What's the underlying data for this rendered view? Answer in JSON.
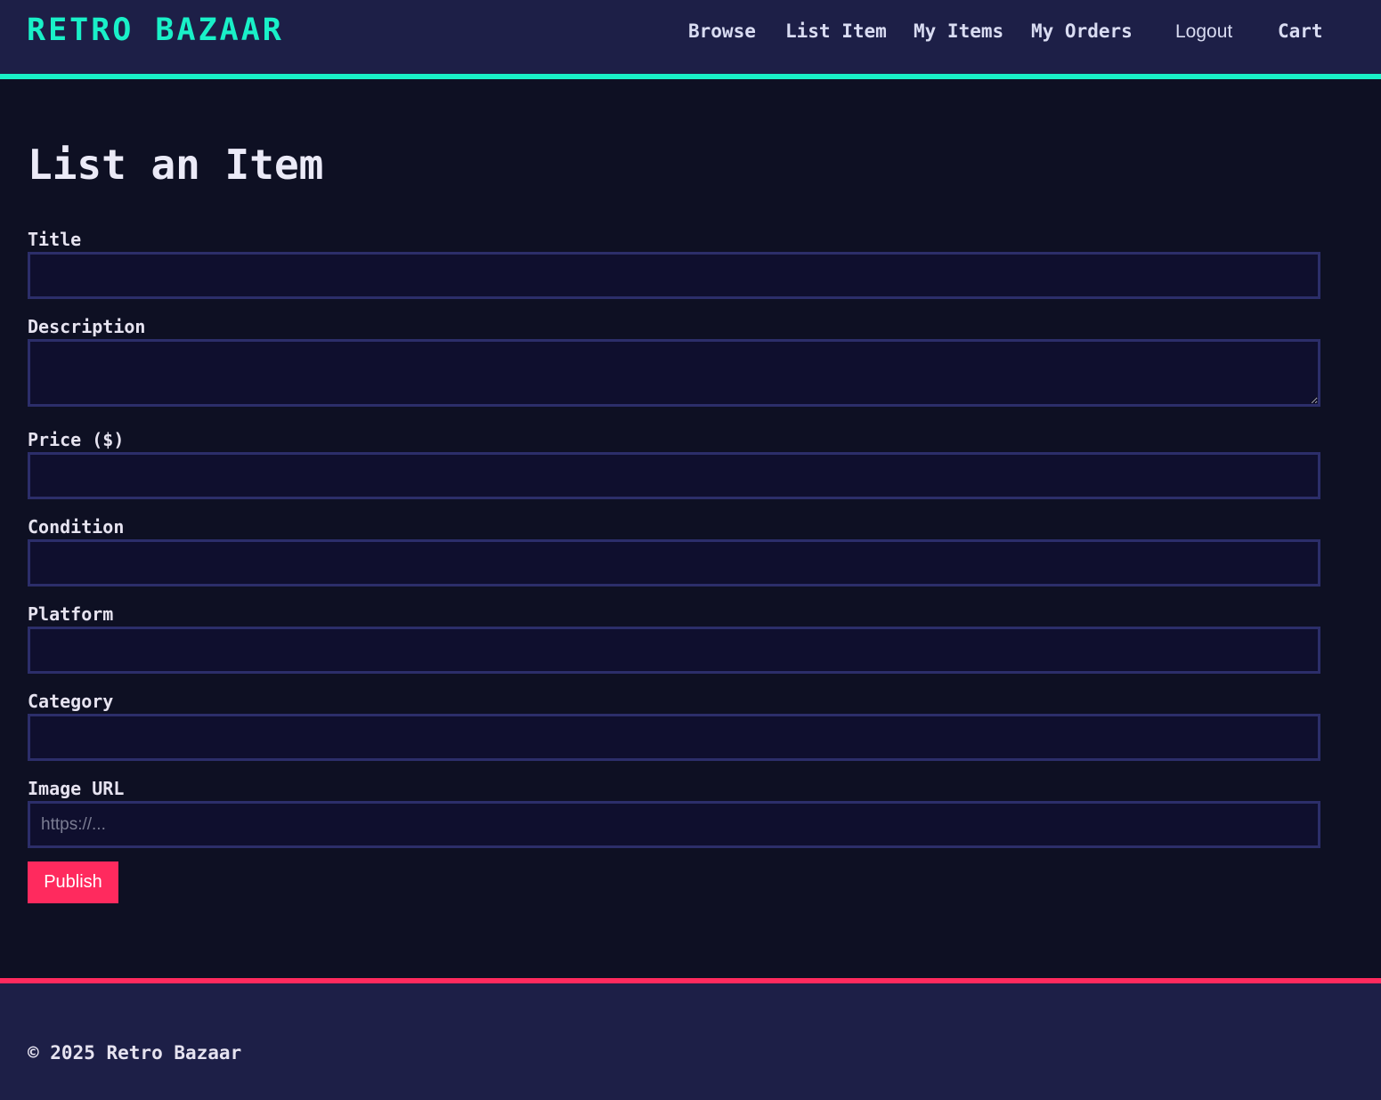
{
  "header": {
    "brand": "RETRO BAZAAR",
    "nav": {
      "browse": "Browse",
      "list_item": "List Item",
      "my_items": "My Items",
      "my_orders": "My Orders",
      "logout": "Logout",
      "cart": "Cart"
    }
  },
  "main": {
    "title": "List an Item",
    "fields": {
      "title": {
        "label": "Title",
        "value": "",
        "placeholder": ""
      },
      "description": {
        "label": "Description",
        "value": "",
        "placeholder": ""
      },
      "price": {
        "label": "Price ($)",
        "value": "",
        "placeholder": ""
      },
      "condition": {
        "label": "Condition",
        "value": "",
        "placeholder": ""
      },
      "platform": {
        "label": "Platform",
        "value": "",
        "placeholder": ""
      },
      "category": {
        "label": "Category",
        "value": "",
        "placeholder": ""
      },
      "image_url": {
        "label": "Image URL",
        "value": "",
        "placeholder": "https://..."
      }
    },
    "publish_label": "Publish"
  },
  "footer": {
    "text": "© 2025 Retro Bazaar"
  },
  "colors": {
    "accent": "#19f0c8",
    "cta": "#ff2a5e",
    "header_bg": "#1d1f47",
    "page_bg": "#0e1023"
  }
}
